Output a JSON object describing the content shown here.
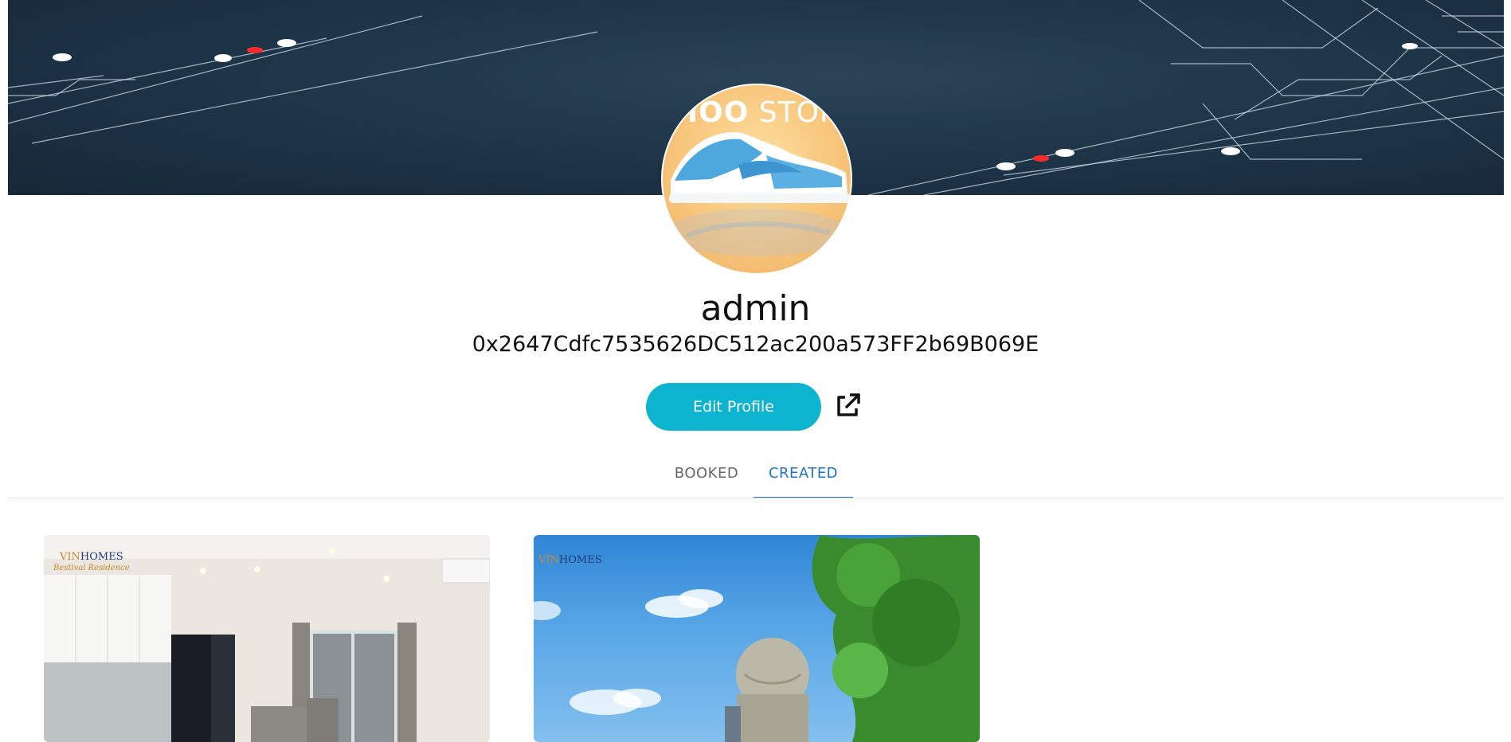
{
  "banner": {
    "image": "circuit-lines-banner"
  },
  "avatar": {
    "store_text_bold": "HOO",
    "store_text_light": " STORE",
    "image": "blue-sneaker"
  },
  "profile": {
    "username": "admin",
    "wallet_address": "0x2647Cdfc7535626DC512ac200a573FF2b69B069E"
  },
  "actions": {
    "edit_profile_label": "Edit Profile",
    "share_icon": "external-link-icon"
  },
  "tabs": [
    {
      "label": "BOOKED",
      "active": false
    },
    {
      "label": "CREATED",
      "active": true
    }
  ],
  "cards": [
    {
      "brand_vin": "VIN",
      "brand_homes": "HOMES",
      "brand_sub": "Bestival Residence",
      "image": "apartment-interior"
    },
    {
      "brand_vin": "VIN",
      "brand_homes": "HOMES",
      "image": "globe-statue-sky"
    }
  ],
  "colors": {
    "accent": "#0db4cf",
    "tab_active": "#1e73c9",
    "banner_bg": "#1d3346"
  }
}
